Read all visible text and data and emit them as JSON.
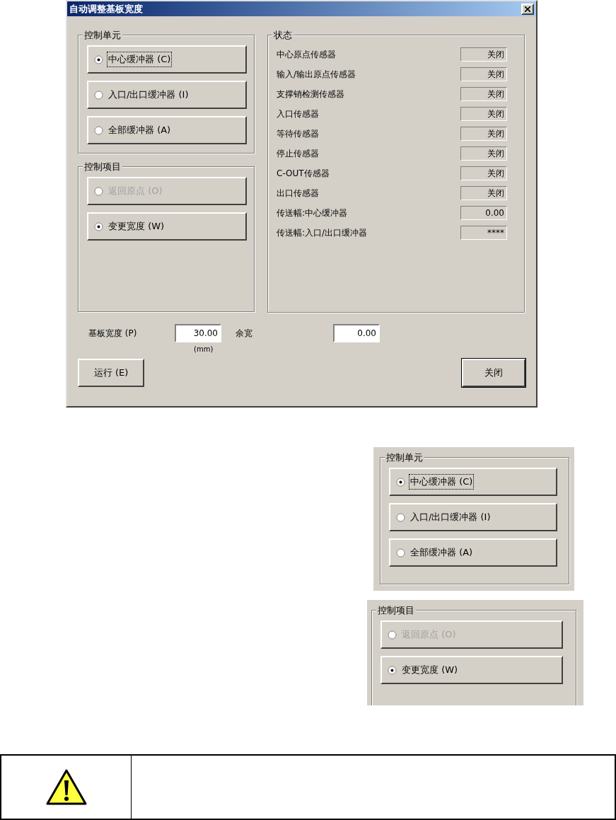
{
  "dialog": {
    "title": "自动调整基板宽度",
    "control_unit": {
      "title": "控制单元",
      "options": [
        {
          "label": "中心缓冲器 (C)",
          "selected": true,
          "disabled": false,
          "focused": true
        },
        {
          "label": "入口/出口缓冲器 (I)",
          "selected": false,
          "disabled": false,
          "focused": false
        },
        {
          "label": "全部缓冲器 (A)",
          "selected": false,
          "disabled": false,
          "focused": false
        }
      ]
    },
    "control_item": {
      "title": "控制项目",
      "options": [
        {
          "label": "返回原点 (O)",
          "selected": false,
          "disabled": true,
          "focused": false
        },
        {
          "label": "变更宽度 (W)",
          "selected": true,
          "disabled": false,
          "focused": false
        }
      ]
    },
    "status": {
      "title": "状态",
      "rows": [
        {
          "label": "中心原点传感器",
          "value": "关闭"
        },
        {
          "label": "输入/输出原点传感器",
          "value": "关闭"
        },
        {
          "label": "支撑销检测传感器",
          "value": "关闭"
        },
        {
          "label": "入口传感器",
          "value": "关闭"
        },
        {
          "label": "等待传感器",
          "value": "关闭"
        },
        {
          "label": "停止传感器",
          "value": "关闭"
        },
        {
          "label": "C-OUT传感器",
          "value": "关闭"
        },
        {
          "label": "出口传感器",
          "value": "关闭"
        },
        {
          "label": "传送幅:中心缓冲器",
          "value": "0.00"
        },
        {
          "label": "传送幅:入口/出口缓冲器",
          "value": "****"
        }
      ]
    },
    "board_width": {
      "label": "基板宽度 (P)",
      "value": "30.00",
      "unit": "(mm)"
    },
    "margin": {
      "label": "余宽",
      "value": "0.00"
    },
    "buttons": {
      "run": "运行 (E)",
      "close": "关闭"
    }
  },
  "inset_control_unit": {
    "title": "控制单元",
    "options": [
      {
        "label": "中心缓冲器 (C)",
        "selected": true,
        "disabled": false,
        "focused": true
      },
      {
        "label": "入口/出口缓冲器 (I)",
        "selected": false,
        "disabled": false,
        "focused": false
      },
      {
        "label": "全部缓冲器 (A)",
        "selected": false,
        "disabled": false,
        "focused": false
      }
    ]
  },
  "inset_control_item": {
    "title": "控制项目",
    "options": [
      {
        "label": "返回原点 (O)",
        "selected": false,
        "disabled": true,
        "focused": false
      },
      {
        "label": "变更宽度 (W)",
        "selected": true,
        "disabled": false,
        "focused": false
      }
    ]
  },
  "warning_note": {
    "kind": "warning"
  }
}
